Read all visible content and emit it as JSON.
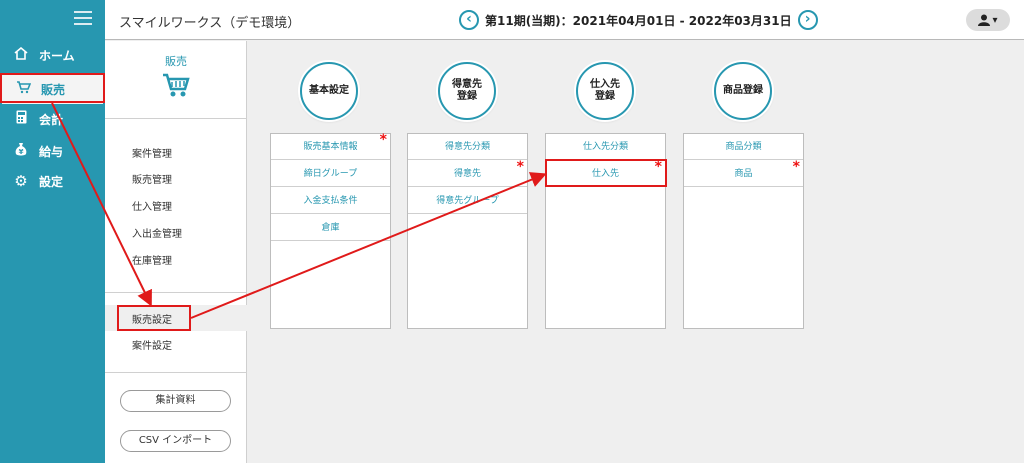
{
  "app": {
    "title": "スマイルワークス（デモ環境）",
    "period": "第11期(当期)：2021年04月01日 - 2022年03月31日",
    "prev_icon": "chevron-left-icon",
    "next_icon": "chevron-right-icon",
    "user_icon": "user-icon",
    "user_caret": "▾"
  },
  "nav": {
    "items": [
      {
        "label": "ホーム",
        "icon": "home-icon",
        "glyph": "⌂",
        "active": false
      },
      {
        "label": "販売",
        "icon": "cart-icon",
        "glyph": "🛒",
        "active": true
      },
      {
        "label": "会計",
        "icon": "calculator-icon",
        "glyph": "▦",
        "active": false
      },
      {
        "label": "給与",
        "icon": "money-bag-icon",
        "glyph": "¥",
        "active": false
      },
      {
        "label": "設定",
        "icon": "gear-icon",
        "glyph": "⚙",
        "active": false
      }
    ]
  },
  "sub": {
    "title": "販売",
    "menu": [
      "案件管理",
      "販売管理",
      "仕入管理",
      "入出金管理",
      "在庫管理"
    ],
    "settings": [
      "販売設定",
      "案件設定"
    ],
    "buttons": [
      "集計資料",
      "CSV インポート"
    ]
  },
  "columns": [
    {
      "title_lines": [
        "基本設定"
      ],
      "rows": [
        {
          "label": "販売基本情報",
          "required": true
        },
        {
          "label": "締日グループ",
          "required": false
        },
        {
          "label": "入金支払条件",
          "required": false
        },
        {
          "label": "倉庫",
          "required": false
        }
      ]
    },
    {
      "title_lines": [
        "得意先",
        "登録"
      ],
      "rows": [
        {
          "label": "得意先分類",
          "required": false
        },
        {
          "label": "得意先",
          "required": true
        },
        {
          "label": "得意先グループ",
          "required": false
        }
      ]
    },
    {
      "title_lines": [
        "仕入先",
        "登録"
      ],
      "rows": [
        {
          "label": "仕入先分類",
          "required": false
        },
        {
          "label": "仕入先",
          "required": true
        }
      ]
    },
    {
      "title_lines": [
        "商品登録"
      ],
      "rows": [
        {
          "label": "商品分類",
          "required": false
        },
        {
          "label": "商品",
          "required": true
        }
      ]
    }
  ],
  "required_mark": "*",
  "colors": {
    "accent": "#2797b0",
    "annotation": "#e01a1a",
    "required": "#e11111"
  }
}
